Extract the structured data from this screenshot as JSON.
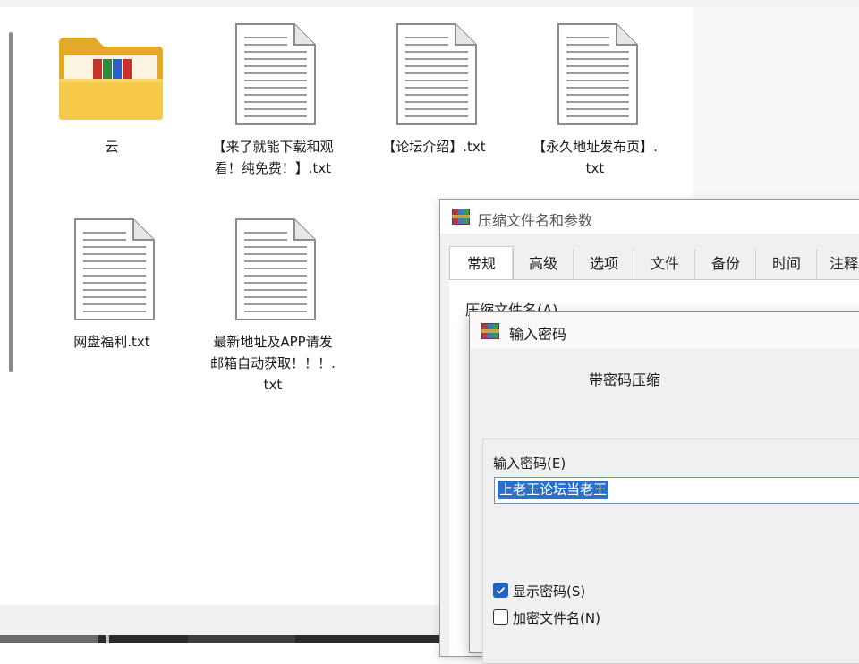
{
  "explorer": {
    "files": [
      {
        "name": "云",
        "type": "folder"
      },
      {
        "name": "【来了就能下载和观看！纯免费！】.txt",
        "type": "txt"
      },
      {
        "name": "【论坛介绍】.txt",
        "type": "txt"
      },
      {
        "name": "【永久地址发布页】.txt",
        "type": "txt"
      },
      {
        "name": "网盘福利.txt",
        "type": "txt"
      },
      {
        "name": "最新地址及APP请发邮箱自动获取！！！.txt",
        "type": "txt"
      }
    ]
  },
  "archive_dialog": {
    "title": "压缩文件名和参数",
    "tabs": [
      "常规",
      "高级",
      "选项",
      "文件",
      "备份",
      "时间",
      "注释"
    ],
    "active_tab": "常规",
    "archive_name_label": "压缩文件名(A)"
  },
  "password_dialog": {
    "title": "输入密码",
    "subtitle": "带密码压缩",
    "password_label": "输入密码(E)",
    "password_value": "上老王论坛当老王",
    "show_password": {
      "label": "显示密码(S)",
      "checked": true
    },
    "encrypt_filenames": {
      "label": "加密文件名(N)",
      "checked": false
    }
  },
  "icons": {
    "folder": "folder-icon",
    "text_file": "text-file-icon",
    "app_logo": "winrar-icon",
    "dropdown": "chevron-down-icon",
    "checkmark": "check-icon"
  },
  "colors": {
    "folder_yellow": "#f5c242",
    "selection_blue": "#2a6fc9",
    "checkbox_blue": "#1f65c8",
    "dialog_bg": "#f0f0f0"
  }
}
